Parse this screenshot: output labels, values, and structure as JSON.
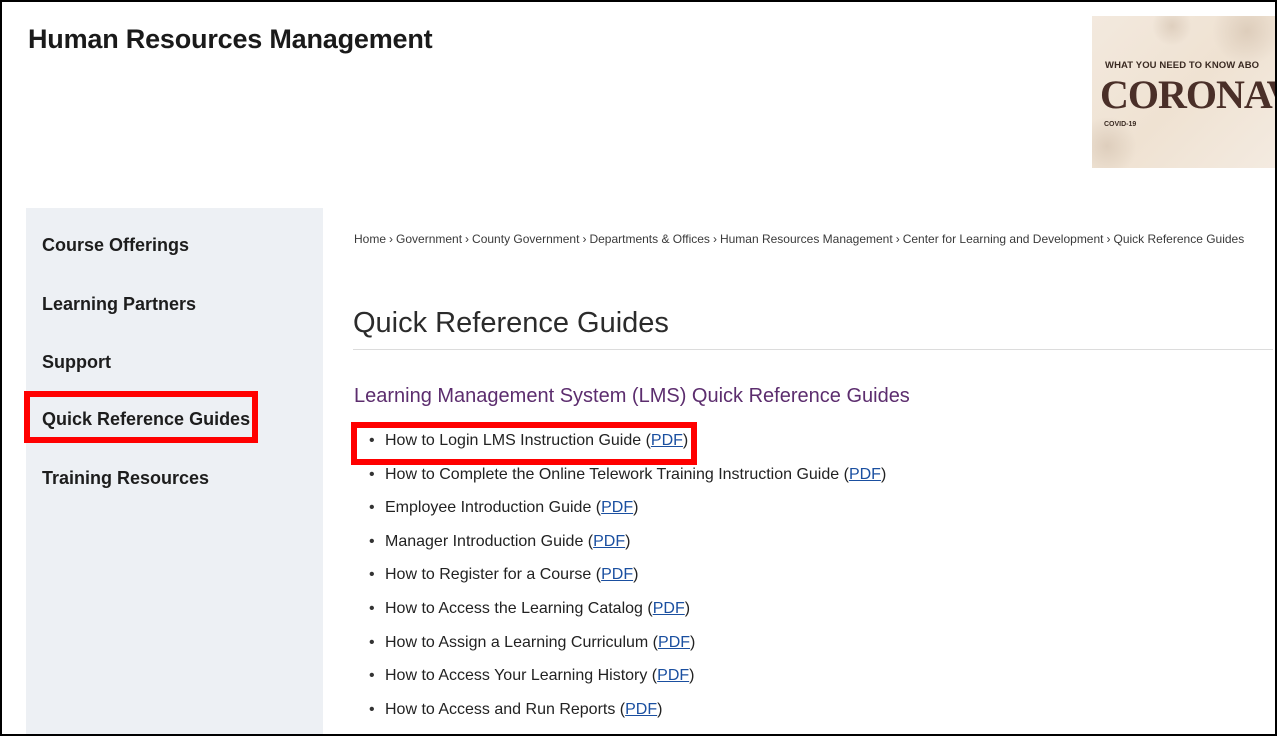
{
  "header": {
    "site_title": "Human Resources Management",
    "banner": {
      "kicker": "WHAT YOU NEED TO KNOW ABO",
      "headline": "CORONAVI",
      "sub": "COVID-19"
    }
  },
  "sidebar": {
    "items": [
      {
        "label": "Course Offerings"
      },
      {
        "label": "Learning Partners"
      },
      {
        "label": "Support"
      },
      {
        "label": "Quick Reference Guides",
        "highlighted": true
      },
      {
        "label": "Training Resources"
      }
    ]
  },
  "breadcrumb": {
    "separator": "›",
    "items": [
      "Home",
      "Government",
      "County Government",
      "Departments & Offices",
      "Human Resources Management",
      "Center for Learning and Development",
      "Quick Reference Guides"
    ]
  },
  "main": {
    "page_title": "Quick Reference Guides",
    "section_heading": "Learning Management System (LMS) Quick Reference Guides",
    "guides": [
      {
        "title": "How to Login LMS Instruction Guide",
        "link": "PDF",
        "highlighted": true
      },
      {
        "title": "How to Complete the Online Telework Training Instruction Guide",
        "link": "PDF"
      },
      {
        "title": "Employee Introduction Guide",
        "link": "PDF"
      },
      {
        "title": "Manager Introduction Guide",
        "link": "PDF"
      },
      {
        "title": "How to Register for a Course",
        "link": "PDF"
      },
      {
        "title": "How to Access the Learning Catalog",
        "link": "PDF"
      },
      {
        "title": "How to Assign a Learning Curriculum",
        "link": "PDF"
      },
      {
        "title": "How to Access Your Learning History",
        "link": "PDF"
      },
      {
        "title": "How to Access and Run Reports",
        "link": "PDF"
      }
    ]
  },
  "colors": {
    "highlight": "#ff0000",
    "section_heading": "#5c2d6e",
    "link": "#1a4fa0",
    "sidebar_bg": "#edf0f4"
  }
}
